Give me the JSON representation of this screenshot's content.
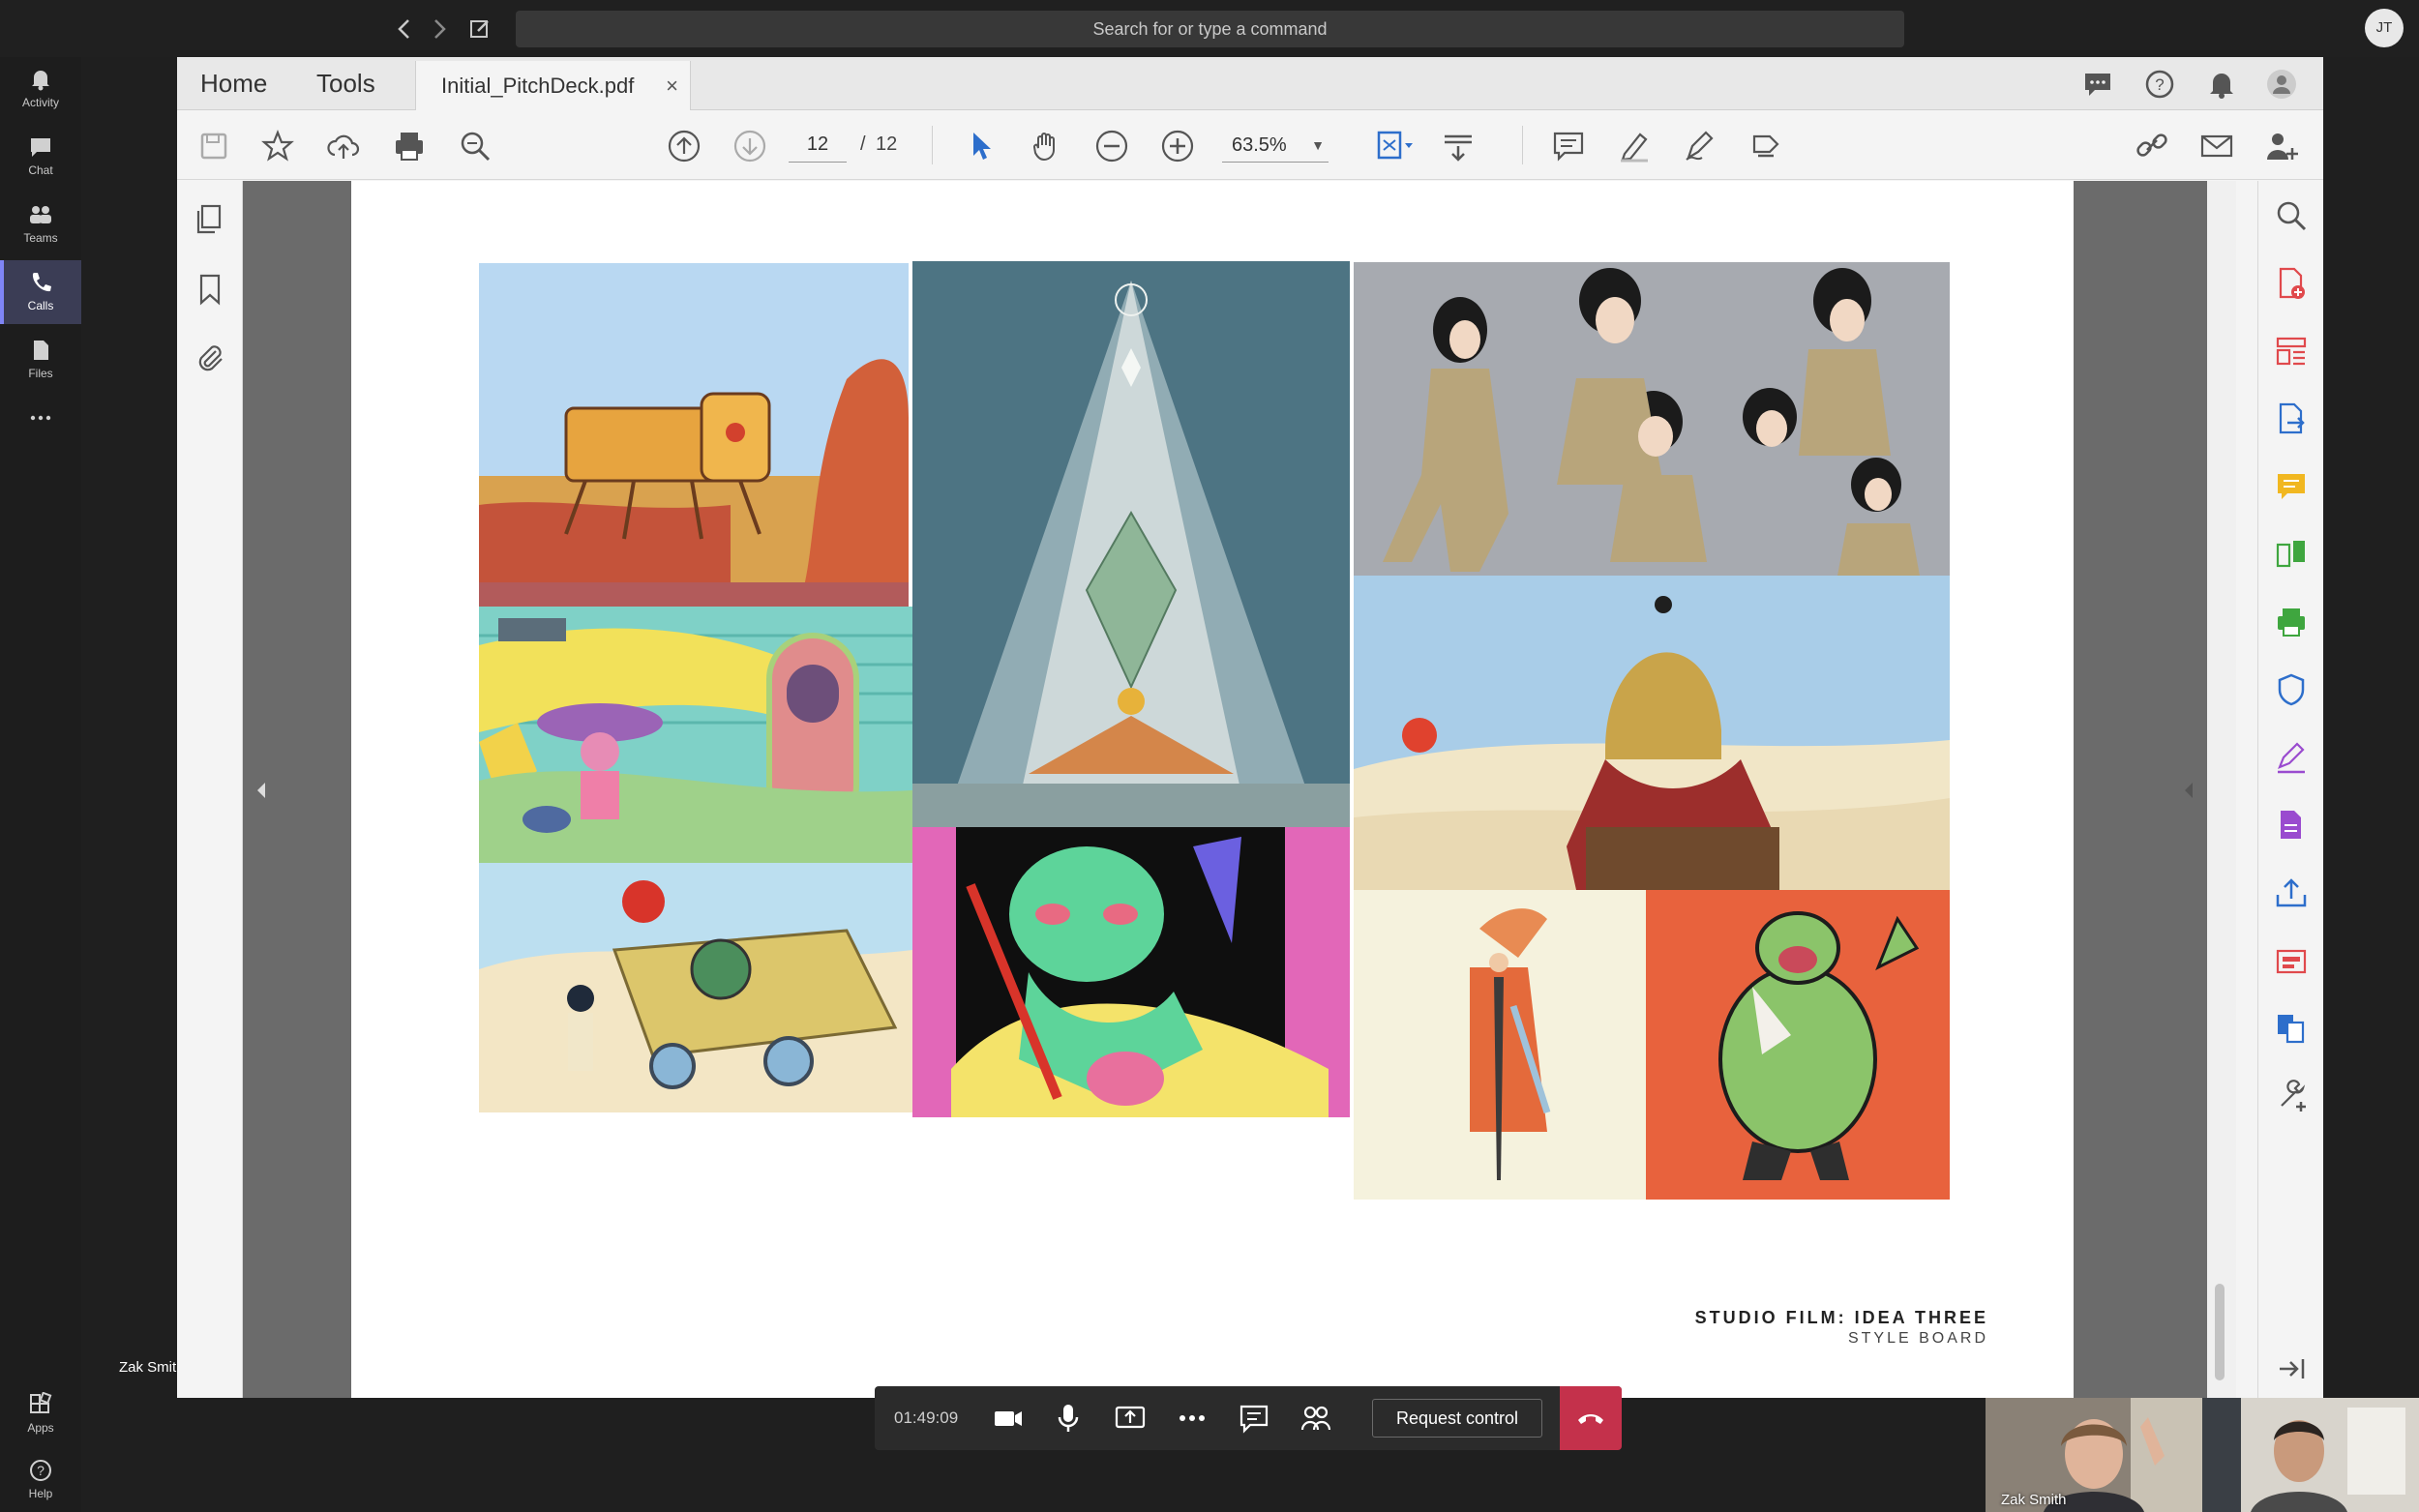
{
  "teams": {
    "search_placeholder": "Search for or type a command",
    "user_initials": "JT",
    "rail": [
      {
        "label": "Activity",
        "icon": "bell-icon"
      },
      {
        "label": "Chat",
        "icon": "chat-icon"
      },
      {
        "label": "Teams",
        "icon": "teams-icon"
      },
      {
        "label": "Calls",
        "icon": "phone-icon",
        "active": true
      },
      {
        "label": "Files",
        "icon": "file-icon"
      },
      {
        "label": "",
        "icon": "more-icon"
      }
    ],
    "rail_bottom": [
      {
        "label": "Apps",
        "icon": "apps-icon"
      },
      {
        "label": "Help",
        "icon": "help-icon"
      }
    ]
  },
  "acrobat": {
    "tabs": {
      "home": "Home",
      "tools": "Tools",
      "document": "Initial_PitchDeck.pdf",
      "close": "×"
    },
    "page_current": "12",
    "page_separator": "/",
    "page_total": "12",
    "zoom": "63.5%"
  },
  "document": {
    "caption_title": "STUDIO FILM: IDEA THREE",
    "caption_subtitle": "STYLE BOARD"
  },
  "meeting": {
    "timer": "01:49:09",
    "request_control": "Request control",
    "presenter_name": "Zak Smith",
    "participants": [
      {
        "name": "Zak Smith"
      },
      {
        "name": ""
      }
    ]
  },
  "colors": {
    "teams_bg": "#1f1f1f",
    "teams_accent": "#7f85f5",
    "hangup": "#c4314b",
    "acrobat_red": "#e0494c",
    "acrobat_blue": "#2d6ecb"
  }
}
